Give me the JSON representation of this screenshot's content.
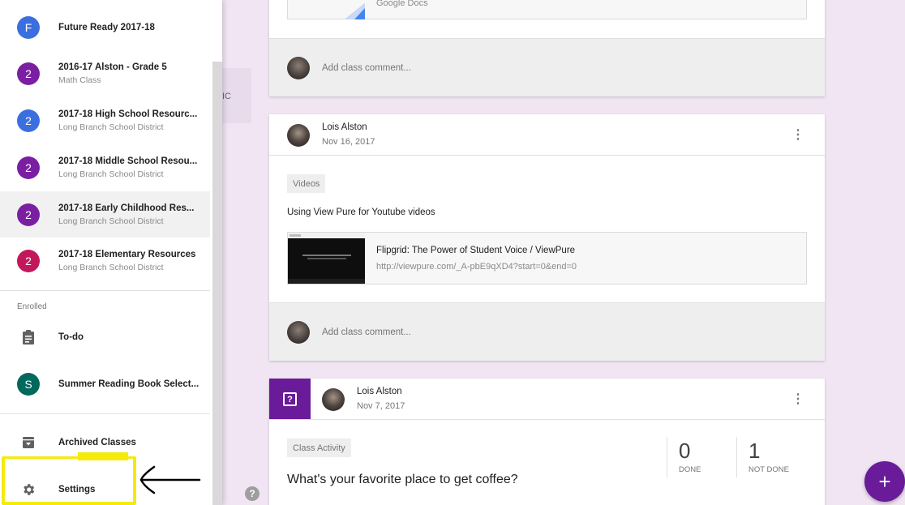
{
  "drawer": {
    "classes": [
      {
        "initial": "F",
        "title": "Future Ready 2017-18",
        "subtitle": "",
        "color": "#3b6fe0"
      },
      {
        "initial": "2",
        "title": "2016-17 Alston - Grade 5",
        "subtitle": "Math Class",
        "color": "#7b1fa2"
      },
      {
        "initial": "2",
        "title": "2017-18 High School Resourc...",
        "subtitle": "Long Branch School District",
        "color": "#3b6fe0"
      },
      {
        "initial": "2",
        "title": "2017-18 Middle School Resou...",
        "subtitle": "Long Branch School District",
        "color": "#7b1fa2"
      },
      {
        "initial": "2",
        "title": "2017-18 Early Childhood Res...",
        "subtitle": "Long Branch School District",
        "color": "#7b1fa2"
      },
      {
        "initial": "2",
        "title": "2017-18 Elementary Resources",
        "subtitle": "Long Branch School District",
        "color": "#c2185b"
      }
    ],
    "enrolled_label": "Enrolled",
    "todo_label": "To-do",
    "enrolled_class": {
      "initial": "S",
      "title": "Summer Reading Book Select...",
      "color": "#00695c"
    },
    "archived_label": "Archived Classes",
    "settings_label": "Settings"
  },
  "stream": {
    "topic_stub": "IC",
    "top_card": {
      "attachment_source": "Google Docs",
      "comment_placeholder": "Add class comment..."
    },
    "post": {
      "author": "Lois Alston",
      "date": "Nov 16, 2017",
      "topic": "Videos",
      "text": "Using View Pure for Youtube videos",
      "link_title": "Flipgrid: The Power of Student Voice / ViewPure",
      "link_url": "http://viewpure.com/_A-pbE9qXD4?start=0&end=0",
      "comment_placeholder": "Add class comment..."
    },
    "question": {
      "author": "Lois Alston",
      "date": "Nov 7, 2017",
      "topic": "Class Activity",
      "title": "What's your favorite place to get coffee?",
      "done_count": "0",
      "done_label": "DONE",
      "not_done_count": "1",
      "not_done_label": "NOT DONE"
    }
  },
  "fab_label": "+",
  "help_label": "?",
  "accent_color": "#6a1b9a",
  "highlight_color": "#f5ea0c"
}
